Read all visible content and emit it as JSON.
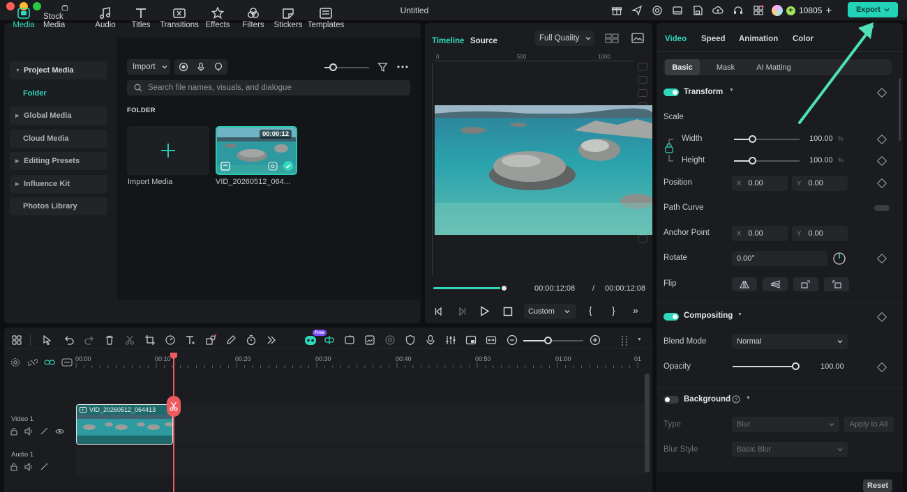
{
  "titlebar": {
    "title": "Untitled",
    "credits": "10805",
    "export_label": "Export"
  },
  "media_tabs": [
    {
      "label": "Media"
    },
    {
      "label": "Stock Media"
    },
    {
      "label": "Audio"
    },
    {
      "label": "Titles"
    },
    {
      "label": "Transitions"
    },
    {
      "label": "Effects"
    },
    {
      "label": "Filters"
    },
    {
      "label": "Stickers"
    },
    {
      "label": "Templates"
    }
  ],
  "sidebar": {
    "items": [
      {
        "label": "Project Media"
      },
      {
        "label": "Folder"
      },
      {
        "label": "Global Media"
      },
      {
        "label": "Cloud Media"
      },
      {
        "label": "Editing Presets"
      },
      {
        "label": "Influence Kit"
      },
      {
        "label": "Photos Library"
      }
    ]
  },
  "media": {
    "import_label": "Import",
    "search_placeholder": "Search file names, visuals, and dialogue",
    "folder_heading": "FOLDER",
    "import_tile_label": "Import Media",
    "clip_name": "VID_20260512_064...",
    "clip_duration": "00:00:12"
  },
  "preview": {
    "tab_timeline": "Timeline",
    "tab_source": "Source",
    "quality": "Full Quality",
    "ruler_labels": [
      "0",
      "500",
      "1000"
    ],
    "current_time": "00:00:12:08",
    "time_sep": "/",
    "total_time": "00:00:12:08",
    "zoom": "Custom",
    "progress": 1.0
  },
  "props": {
    "tabs": [
      {
        "label": "Video"
      },
      {
        "label": "Speed"
      },
      {
        "label": "Animation"
      },
      {
        "label": "Color"
      }
    ],
    "subtabs": [
      {
        "label": "Basic"
      },
      {
        "label": "Mask"
      },
      {
        "label": "AI Matting"
      }
    ],
    "transform": {
      "title": "Transform",
      "scale": "Scale",
      "width_label": "Width",
      "width_value": "100.00",
      "height_label": "Height",
      "height_value": "100.00",
      "unit": "%",
      "position": "Position",
      "pos_x": "0.00",
      "pos_y": "0.00",
      "x": "X",
      "y": "Y",
      "path_curve": "Path Curve",
      "anchor": "Anchor Point",
      "anchor_x": "0.00",
      "anchor_y": "0.00",
      "rotate": "Rotate",
      "rotate_value": "0.00°",
      "flip": "Flip"
    },
    "compositing": {
      "title": "Compositing",
      "blend_label": "Blend Mode",
      "blend_value": "Normal",
      "opacity_label": "Opacity",
      "opacity_value": "100.00"
    },
    "background": {
      "title": "Background",
      "type_label": "Type",
      "type_value": "Blur",
      "apply_all": "Apply to All",
      "style_label": "Blur Style",
      "style_value": "Basic Blur"
    },
    "reset": "Reset"
  },
  "timeline": {
    "ruler_labels": [
      "00:00",
      "00:10",
      "00:20",
      "00:30",
      "00:40",
      "00:50",
      "01:00",
      "01"
    ],
    "video_track": "Video 1",
    "audio_track": "Audio 1",
    "clip_name": "VID_20260512_064413",
    "ai_badge": "Free"
  },
  "colors": {
    "accent": "#2fd7bd",
    "playhead": "#f05a5f",
    "export": "#22d3b8"
  }
}
